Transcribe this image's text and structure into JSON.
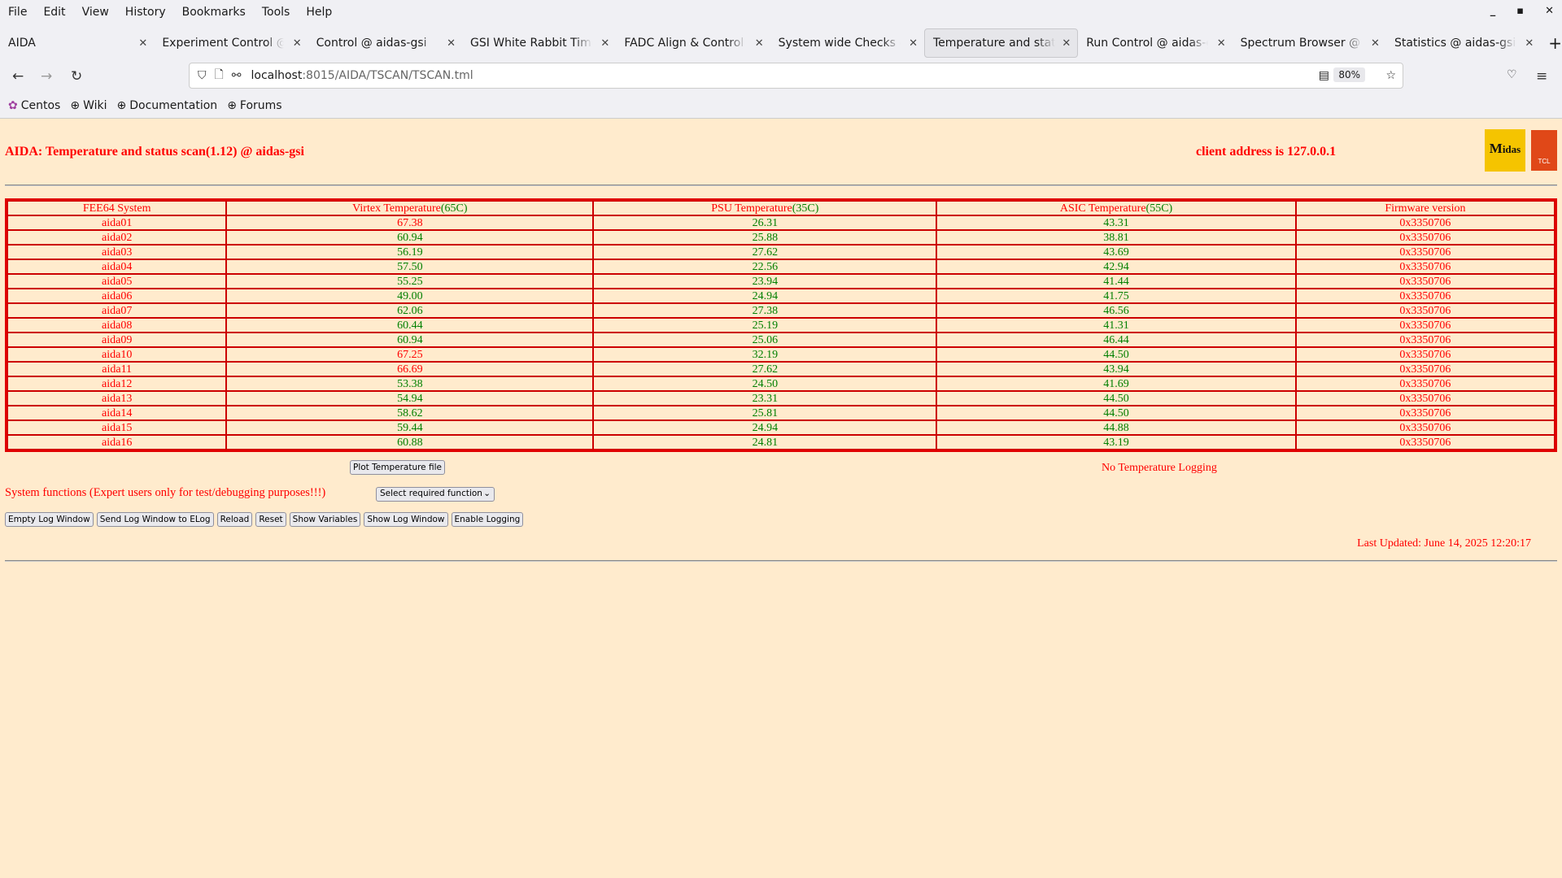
{
  "browser": {
    "menu": [
      "File",
      "Edit",
      "View",
      "History",
      "Bookmarks",
      "Tools",
      "Help"
    ],
    "tabs": [
      {
        "label": "AIDA"
      },
      {
        "label": "Experiment Control @ aidas-gsi"
      },
      {
        "label": "Control @ aidas-gsi"
      },
      {
        "label": "GSI White Rabbit Timestamp"
      },
      {
        "label": "FADC Align & Control @ aidas-gsi"
      },
      {
        "label": "System wide Checks @ aidas-gsi"
      },
      {
        "label": "Temperature and status scan",
        "active": true
      },
      {
        "label": "Run Control @ aidas-gsi"
      },
      {
        "label": "Spectrum Browser @ aidas-gsi"
      },
      {
        "label": "Statistics @ aidas-gsi"
      }
    ],
    "url_host": "localhost",
    "url_path": ":8015/AIDA/TSCAN/TSCAN.tml",
    "zoom": "80%",
    "bookmarks": [
      "Centos",
      "Wiki",
      "Documentation",
      "Forums"
    ]
  },
  "page": {
    "title": "AIDA: Temperature and status scan(1.12) @ aidas-gsi",
    "client": "client address is 127.0.0.1",
    "logo_text": "Midas",
    "logo2_text": "TCL",
    "table": {
      "headers": [
        {
          "label": "FEE64 System",
          "limit": ""
        },
        {
          "label": "Virtex Temperature",
          "limit": "(65C)"
        },
        {
          "label": "PSU Temperature",
          "limit": "(35C)"
        },
        {
          "label": "ASIC Temperature",
          "limit": "(55C)"
        },
        {
          "label": "Firmware version",
          "limit": ""
        }
      ],
      "limits": [
        65,
        35,
        55
      ],
      "rows": [
        [
          "aida01",
          "67.38",
          "26.31",
          "43.31",
          "0x3350706"
        ],
        [
          "aida02",
          "60.94",
          "25.88",
          "38.81",
          "0x3350706"
        ],
        [
          "aida03",
          "56.19",
          "27.62",
          "43.69",
          "0x3350706"
        ],
        [
          "aida04",
          "57.50",
          "22.56",
          "42.94",
          "0x3350706"
        ],
        [
          "aida05",
          "55.25",
          "23.94",
          "41.44",
          "0x3350706"
        ],
        [
          "aida06",
          "49.00",
          "24.94",
          "41.75",
          "0x3350706"
        ],
        [
          "aida07",
          "62.06",
          "27.38",
          "46.56",
          "0x3350706"
        ],
        [
          "aida08",
          "60.44",
          "25.19",
          "41.31",
          "0x3350706"
        ],
        [
          "aida09",
          "60.94",
          "25.06",
          "46.44",
          "0x3350706"
        ],
        [
          "aida10",
          "67.25",
          "32.19",
          "44.50",
          "0x3350706"
        ],
        [
          "aida11",
          "66.69",
          "27.62",
          "43.94",
          "0x3350706"
        ],
        [
          "aida12",
          "53.38",
          "24.50",
          "41.69",
          "0x3350706"
        ],
        [
          "aida13",
          "54.94",
          "23.31",
          "44.50",
          "0x3350706"
        ],
        [
          "aida14",
          "58.62",
          "25.81",
          "44.50",
          "0x3350706"
        ],
        [
          "aida15",
          "59.44",
          "24.94",
          "44.88",
          "0x3350706"
        ],
        [
          "aida16",
          "60.88",
          "24.81",
          "43.19",
          "0x3350706"
        ]
      ]
    },
    "plot_button": "Plot Temperature file",
    "logging_status": "No Temperature Logging",
    "system_functions_label": "System functions (Expert users only for test/debugging purposes!!!)",
    "select_value": "Select required function",
    "buttons": [
      "Empty Log Window",
      "Send Log Window to ELog",
      "Reload",
      "Reset",
      "Show Variables",
      "Show Log Window",
      "Enable Logging"
    ],
    "last_updated": "Last Updated: June 14, 2025 12:20:17"
  },
  "colors": {
    "background": "#ffebcd",
    "alarm": "#ff0000",
    "ok": "#008000",
    "border": "#cc0000"
  }
}
